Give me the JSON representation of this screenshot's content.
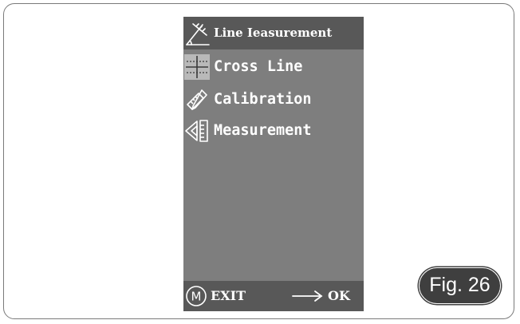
{
  "header": {
    "title": "Line Ieasurement",
    "icon": "ruler-icon"
  },
  "menu": {
    "items": [
      {
        "label": "Cross Line",
        "icon": "cross-line-icon",
        "selected": true
      },
      {
        "label": "Calibration",
        "icon": "calibration-icon",
        "selected": false
      },
      {
        "label": "Measurement",
        "icon": "measurement-icon",
        "selected": false
      }
    ]
  },
  "footer": {
    "exit_label": "EXIT",
    "ok_label": "OK",
    "m_key": "M"
  },
  "figure": {
    "label": "Fig. 26"
  },
  "colors": {
    "screen": "#7e7e7e",
    "bar": "#585858",
    "badge": "#3f3f3f",
    "text": "#ffffff"
  }
}
